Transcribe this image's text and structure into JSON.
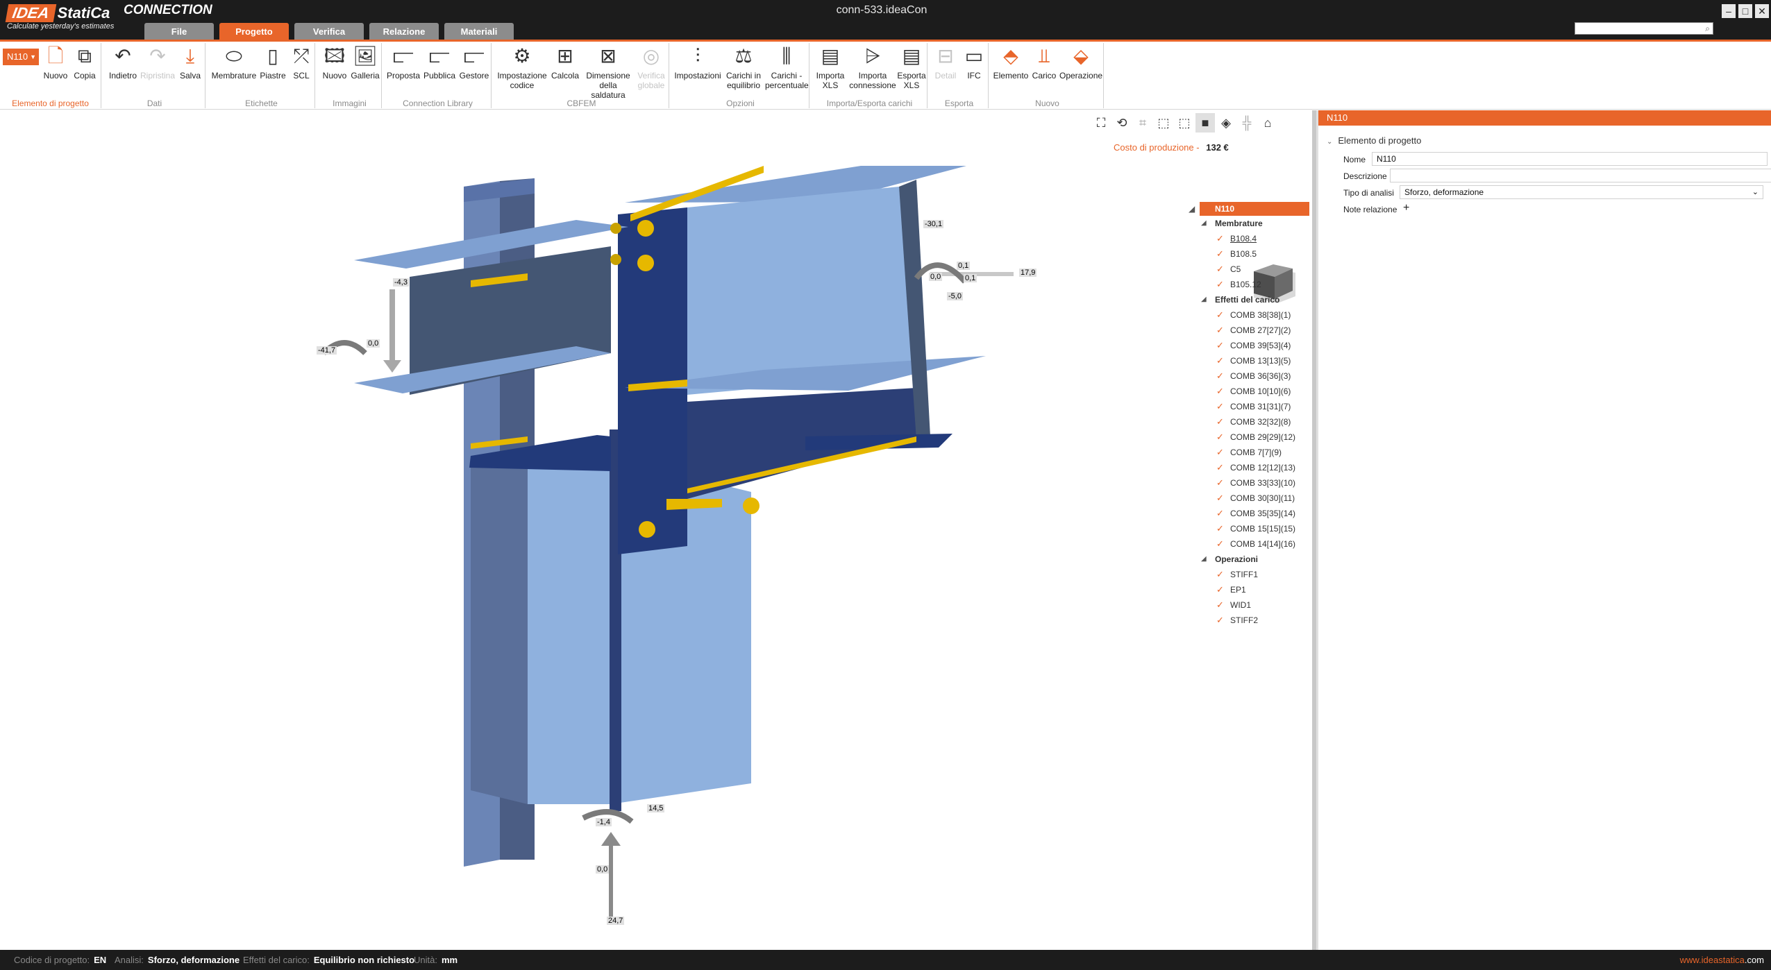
{
  "app": {
    "brand": "IDEA",
    "brand_name": "StatiCa",
    "product": "CONNECTION",
    "tagline": "Calculate yesterday's estimates",
    "window_title": "conn-533.ideaCon",
    "search_placeholder": ""
  },
  "window_buttons": [
    "–",
    "□",
    "✕"
  ],
  "tabs": [
    {
      "label": "File",
      "active": false
    },
    {
      "label": "Progetto",
      "active": true
    },
    {
      "label": "Verifica",
      "active": false
    },
    {
      "label": "Relazione",
      "active": false
    },
    {
      "label": "Materiali",
      "active": false
    }
  ],
  "ribbon": {
    "project_item": {
      "value": "N110",
      "group_label": "Elemento di progetto",
      "new_label": "Nuovo",
      "copy_label": "Copia"
    },
    "groups": {
      "dati": {
        "label": "Dati",
        "undo": "Indietro",
        "redo": "Ripristina",
        "save": "Salva"
      },
      "etichette": {
        "label": "Etichette",
        "members": "Membrature",
        "plates": "Piastre",
        "scl": "SCL"
      },
      "immagini": {
        "label": "Immagini",
        "new": "Nuovo",
        "gallery": "Galleria"
      },
      "library": {
        "label": "Connection Library",
        "proposal": "Proposta",
        "publish": "Pubblica",
        "manager": "Gestore"
      },
      "cbfem": {
        "label": "CBFEM",
        "code_setup": "Impostazione codice",
        "calculate": "Calcola",
        "weld_sizing": "Dimensione della saldatura",
        "global_check": "Verifica globale"
      },
      "opzioni": {
        "label": "Opzioni",
        "settings": "Impostazioni",
        "equilibrium": "Carichi in equilibrio",
        "percentage": "Carichi - percentuale"
      },
      "import_export": {
        "label": "Importa/Esporta carichi",
        "import_xls": "Importa XLS",
        "import_connection": "Importa connessione",
        "export_xls": "Esporta XLS"
      },
      "esporta": {
        "label": "Esporta",
        "detail": "Detail",
        "ifc": "IFC"
      },
      "nuovo": {
        "label": "Nuovo",
        "element": "Elemento",
        "load": "Carico",
        "operation": "Operazione"
      }
    }
  },
  "viewport": {
    "cost_label": "Costo di produzione",
    "cost_sep": "-",
    "cost_value": "132 €",
    "load_values": [
      "-30,1",
      "0,1",
      "0,0",
      "0,1",
      "-5,0",
      "17,9",
      "-4,3",
      "-41,7",
      "0,0",
      "14,5",
      "-1,4",
      "0,0",
      "24,7"
    ]
  },
  "tree": {
    "root": "N110",
    "members_label": "Membrature",
    "members": [
      "B108.4",
      "B108.5",
      "C5",
      "B105.12"
    ],
    "loads_label": "Effetti del carico",
    "loads": [
      "COMB 38[38](1)",
      "COMB 27[27](2)",
      "COMB 39[53](4)",
      "COMB 13[13](5)",
      "COMB 36[36](3)",
      "COMB 10[10](6)",
      "COMB 31[31](7)",
      "COMB 32[32](8)",
      "COMB 29[29](12)",
      "COMB 7[7](9)",
      "COMB 12[12](13)",
      "COMB 33[33](10)",
      "COMB 30[30](11)",
      "COMB 35[35](14)",
      "COMB 15[15](15)",
      "COMB 14[14](16)"
    ],
    "ops_label": "Operazioni",
    "operations": [
      "STIFF1",
      "EP1",
      "WID1",
      "STIFF2"
    ]
  },
  "props": {
    "header": "N110",
    "section": "Elemento di progetto",
    "name_label": "Nome",
    "name_value": "N110",
    "desc_label": "Descrizione",
    "desc_value": "",
    "analysis_label": "Tipo di analisi",
    "analysis_value": "Sforzo, deformazione",
    "notes_label": "Note relazione",
    "add_symbol": "+"
  },
  "status": {
    "code_label": "Codice di progetto:",
    "code_value": "EN",
    "analysis_label": "Analisi:",
    "analysis_value": "Sforzo, deformazione",
    "loads_label": "Effetti del carico:",
    "loads_value": "Equilibrio non richiesto",
    "units_label": "Unità:",
    "units_value": "mm",
    "url_prefix": "www.",
    "url_brand": "ideastatica",
    "url_suffix": ".com"
  },
  "colors": {
    "accent": "#e8652a",
    "steel_light": "#7a9ccc",
    "steel_dark": "#233a7a",
    "weld": "#e6b800",
    "bolt": "#e6b800"
  }
}
